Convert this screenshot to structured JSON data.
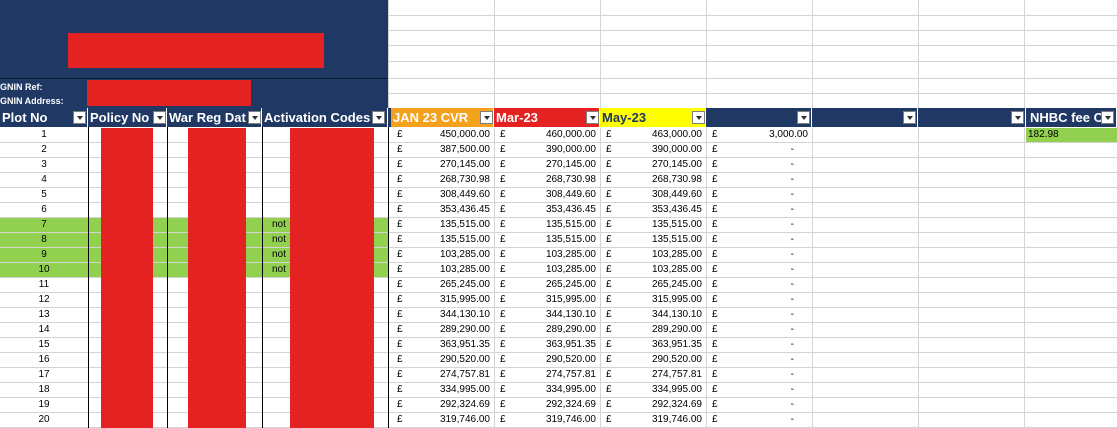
{
  "header": {
    "gnin_ref_label": "GNIN Ref:",
    "gnin_address_label": "GNIN Address:"
  },
  "columns": {
    "plot_no": "Plot No",
    "policy_no": "Policy No",
    "war_reg_date": "War Reg Dat",
    "activation_codes": "Activation Codes",
    "jan23": "JAN 23 CVR",
    "mar23": "Mar-23",
    "may23": "May-23",
    "col_e": "",
    "col_f": "",
    "col_g": "",
    "nhbc": "NHBC fee CT"
  },
  "colors": {
    "navy": "#1f3864",
    "jan23": "#f4a11d",
    "mar23": "#e52222",
    "may23": "#ffff00",
    "green_row": "#92d050",
    "redaction": "#e52222"
  },
  "currency": "£",
  "rows": [
    {
      "plot": "1",
      "jan": "450,000.00",
      "mar": "460,000.00",
      "may": "463,000.00",
      "diff": "3,000.00",
      "nhbc": "182.98",
      "activation": "",
      "green": false
    },
    {
      "plot": "2",
      "jan": "387,500.00",
      "mar": "390,000.00",
      "may": "390,000.00",
      "diff": "-",
      "nhbc": "",
      "activation": "",
      "green": false
    },
    {
      "plot": "3",
      "jan": "270,145.00",
      "mar": "270,145.00",
      "may": "270,145.00",
      "diff": "-",
      "nhbc": "",
      "activation": "",
      "green": false
    },
    {
      "plot": "4",
      "jan": "268,730.98",
      "mar": "268,730.98",
      "may": "268,730.98",
      "diff": "-",
      "nhbc": "",
      "activation": "",
      "green": false
    },
    {
      "plot": "5",
      "jan": "308,449.60",
      "mar": "308,449.60",
      "may": "308,449.60",
      "diff": "-",
      "nhbc": "",
      "activation": "",
      "green": false
    },
    {
      "plot": "6",
      "jan": "353,436.45",
      "mar": "353,436.45",
      "may": "353,436.45",
      "diff": "-",
      "nhbc": "",
      "activation": "",
      "green": false
    },
    {
      "plot": "7",
      "jan": "135,515.00",
      "mar": "135,515.00",
      "may": "135,515.00",
      "diff": "-",
      "nhbc": "",
      "activation": "not",
      "green": true
    },
    {
      "plot": "8",
      "jan": "135,515.00",
      "mar": "135,515.00",
      "may": "135,515.00",
      "diff": "-",
      "nhbc": "",
      "activation": "not",
      "green": true
    },
    {
      "plot": "9",
      "jan": "103,285.00",
      "mar": "103,285.00",
      "may": "103,285.00",
      "diff": "-",
      "nhbc": "",
      "activation": "not",
      "green": true
    },
    {
      "plot": "10",
      "jan": "103,285.00",
      "mar": "103,285.00",
      "may": "103,285.00",
      "diff": "-",
      "nhbc": "",
      "activation": "not",
      "green": true
    },
    {
      "plot": "11",
      "jan": "265,245.00",
      "mar": "265,245.00",
      "may": "265,245.00",
      "diff": "-",
      "nhbc": "",
      "activation": "",
      "green": false
    },
    {
      "plot": "12",
      "jan": "315,995.00",
      "mar": "315,995.00",
      "may": "315,995.00",
      "diff": "-",
      "nhbc": "",
      "activation": "",
      "green": false
    },
    {
      "plot": "13",
      "jan": "344,130.10",
      "mar": "344,130.10",
      "may": "344,130.10",
      "diff": "-",
      "nhbc": "",
      "activation": "",
      "green": false
    },
    {
      "plot": "14",
      "jan": "289,290.00",
      "mar": "289,290.00",
      "may": "289,290.00",
      "diff": "-",
      "nhbc": "",
      "activation": "",
      "green": false
    },
    {
      "plot": "15",
      "jan": "363,951.35",
      "mar": "363,951.35",
      "may": "363,951.35",
      "diff": "-",
      "nhbc": "",
      "activation": "",
      "green": false
    },
    {
      "plot": "16",
      "jan": "290,520.00",
      "mar": "290,520.00",
      "may": "290,520.00",
      "diff": "-",
      "nhbc": "",
      "activation": "",
      "green": false
    },
    {
      "plot": "17",
      "jan": "274,757.81",
      "mar": "274,757.81",
      "may": "274,757.81",
      "diff": "-",
      "nhbc": "",
      "activation": "",
      "green": false
    },
    {
      "plot": "18",
      "jan": "334,995.00",
      "mar": "334,995.00",
      "may": "334,995.00",
      "diff": "-",
      "nhbc": "",
      "activation": "",
      "green": false
    },
    {
      "plot": "19",
      "jan": "292,324.69",
      "mar": "292,324.69",
      "may": "292,324.69",
      "diff": "-",
      "nhbc": "",
      "activation": "",
      "green": false
    },
    {
      "plot": "20",
      "jan": "319,746.00",
      "mar": "319,746.00",
      "may": "319,746.00",
      "diff": "-",
      "nhbc": "",
      "activation": "",
      "green": false
    }
  ]
}
